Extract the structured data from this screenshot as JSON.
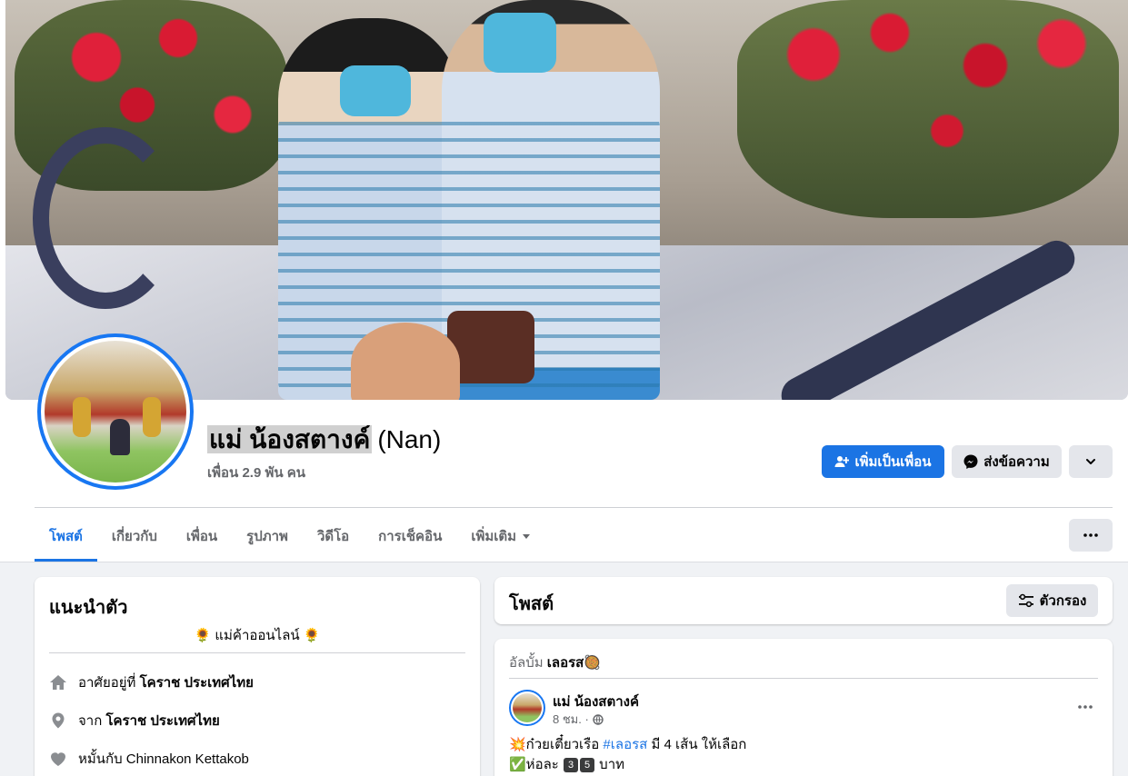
{
  "profile": {
    "name": "แม่ น้องสตางค์",
    "alt_name": "(Nan)",
    "friends": "เพื่อน 2.9 พัน คน"
  },
  "actions": {
    "add_friend": "เพิ่มเป็นเพื่อน",
    "message": "ส่งข้อความ"
  },
  "tabs": [
    {
      "label": "โพสต์"
    },
    {
      "label": "เกี่ยวกับ"
    },
    {
      "label": "เพื่อน"
    },
    {
      "label": "รูปภาพ"
    },
    {
      "label": "วิดีโอ"
    },
    {
      "label": "การเช็คอิน"
    },
    {
      "label": "เพิ่มเติม"
    }
  ],
  "intro": {
    "title": "แนะนำตัว",
    "bio": "🌻 แม่ค้าออนไลน์ 🌻",
    "lives_prefix": "อาศัยอยู่ที่",
    "lives_value": "โคราช ประเทศไทย",
    "from_prefix": "จาก",
    "from_value": "โคราช ประเทศไทย",
    "engaged": "หมั้นกับ Chinnakon Kettakob"
  },
  "posts": {
    "title": "โพสต์",
    "filter": "ตัวกรอง"
  },
  "post": {
    "album_prefix": "อัลบั้ม",
    "album_name": "เลอรส🥘",
    "author": "แม่ น้องสตางค์",
    "time": "8 ชม. ·",
    "line1_a": "💥ก๋วยเตี๋ยวเรือ ",
    "line1_tag": "#เลอรส",
    "line1_b": " มี 4 เส้น ให้เลือก",
    "line2_a": "✅ห่อละ ",
    "line2_n1": "3",
    "line2_n2": "5",
    "line2_b": " บาท"
  },
  "colors": {
    "accent": "#1b74e4",
    "background": "#f0f2f5",
    "secondary_text": "#65676b"
  }
}
